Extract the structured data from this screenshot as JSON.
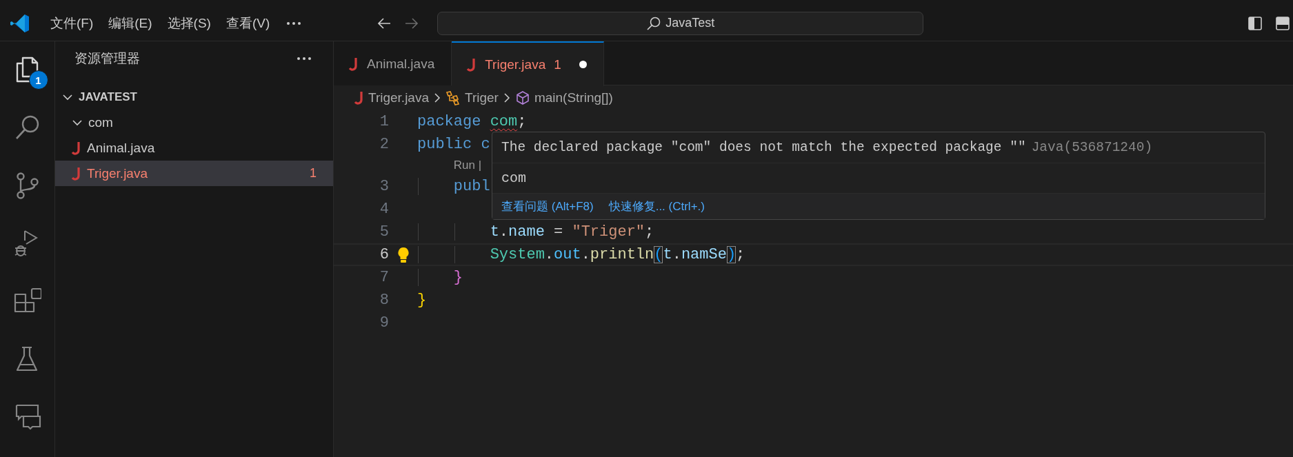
{
  "title_bar": {
    "menu": [
      "文件(F)",
      "编辑(E)",
      "选择(S)",
      "查看(V)"
    ],
    "navigation": [
      {
        "kind": "back",
        "disabled": false
      },
      {
        "kind": "forward",
        "disabled": true
      }
    ],
    "search": "JavaTest"
  },
  "activity_bar": [
    {
      "kind": "explorer",
      "selected": true,
      "badge": "1"
    },
    {
      "kind": "search",
      "selected": false
    },
    {
      "kind": "source-control",
      "selected": false
    },
    {
      "kind": "run-debug",
      "selected": false
    },
    {
      "kind": "extensions",
      "selected": false
    },
    {
      "kind": "testing",
      "selected": false
    },
    {
      "kind": "chat",
      "selected": false
    }
  ],
  "sidebar": {
    "title": "资源管理器",
    "tree": [
      {
        "label": "JAVATEST",
        "kind": "root",
        "expanded": true,
        "children": [
          {
            "label": "com",
            "kind": "folder",
            "expanded": true
          },
          {
            "label": "Animal.java",
            "kind": "file",
            "selected": false,
            "error": false
          },
          {
            "label": "Triger.java",
            "kind": "file",
            "selected": true,
            "error": true,
            "problems": "1"
          }
        ]
      }
    ]
  },
  "tabs": [
    {
      "label": "Animal.java",
      "selected": false,
      "error": false,
      "dirty": false
    },
    {
      "label": "Triger.java",
      "selected": true,
      "error": true,
      "problems": "1",
      "dirty": true
    }
  ],
  "breadcrumb": [
    {
      "kind": "file",
      "label": "Triger.java"
    },
    {
      "kind": "class",
      "label": "Triger"
    },
    {
      "kind": "method",
      "label": "main(String[])"
    }
  ],
  "code": [
    {
      "kind": "code",
      "number": "1",
      "active": false,
      "tokens": [
        {
          "t": "package ",
          "kind": "keyword"
        },
        {
          "t": "com",
          "kind": "type",
          "error": true
        },
        {
          "t": ";",
          "kind": "plain"
        }
      ]
    },
    {
      "kind": "code",
      "number": "2",
      "active": false,
      "tokens": [
        {
          "t": "public ",
          "kind": "keyword"
        },
        {
          "t": "c",
          "kind": "keyword"
        }
      ]
    },
    {
      "kind": "codelens",
      "text": "    Run |"
    },
    {
      "kind": "code",
      "number": "3",
      "active": false,
      "tokens": [
        {
          "t": "    publ",
          "kind": "keyword"
        }
      ]
    },
    {
      "kind": "code",
      "number": "4",
      "active": false
    },
    {
      "kind": "code",
      "number": "5",
      "active": false,
      "tokens": [
        {
          "t": "        t",
          "kind": "variable"
        },
        {
          "t": ".",
          "kind": "plain"
        },
        {
          "t": "name",
          "kind": "variable"
        },
        {
          "t": " = ",
          "kind": "plain"
        },
        {
          "t": "\"Triger\"",
          "kind": "string"
        },
        {
          "t": ";",
          "kind": "plain"
        }
      ]
    },
    {
      "kind": "code",
      "number": "6",
      "active": true,
      "lightbulb": true,
      "tokens": [
        {
          "t": "        System",
          "kind": "type"
        },
        {
          "t": ".",
          "kind": "plain"
        },
        {
          "t": "out",
          "kind": "constant"
        },
        {
          "t": ".",
          "kind": "plain"
        },
        {
          "t": "println",
          "kind": "function"
        },
        {
          "t": "(",
          "kind": "bracket",
          "matched": true
        },
        {
          "t": "t",
          "kind": "variable"
        },
        {
          "t": ".",
          "kind": "plain"
        },
        {
          "t": "namSe",
          "kind": "variable"
        },
        {
          "t": ")",
          "kind": "bracket",
          "matched": true
        },
        {
          "t": ";",
          "kind": "plain"
        }
      ]
    },
    {
      "kind": "code",
      "number": "7",
      "active": false,
      "tokens": [
        {
          "t": "    }",
          "kind": "bracket2"
        }
      ]
    },
    {
      "kind": "code",
      "number": "8",
      "active": false,
      "tokens": [
        {
          "t": "}",
          "kind": "bracket1"
        }
      ]
    },
    {
      "kind": "code",
      "number": "9",
      "active": false
    }
  ],
  "hover": {
    "message": "The declared package \"com\" does not match the expected package \"\"",
    "source": "Java(536871240)",
    "detail": "com",
    "actions": [
      "查看问题 (Alt+F8)",
      "快速修复... (Ctrl+.)"
    ]
  }
}
